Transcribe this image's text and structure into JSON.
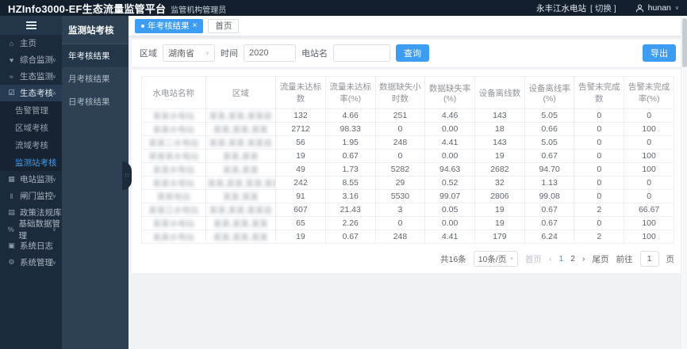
{
  "colors": {
    "accent": "#3d9df2",
    "header_bg": "#141f2e",
    "sidebar_bg": "#1c2b3b",
    "subpanel_bg": "#2e4154",
    "content_bg": "#f0f2f5",
    "table_border": "#ebeef5"
  },
  "header": {
    "title": "HZInfo3000-EF生态流量监管平台",
    "subtitle": "监管机构管理员",
    "station": "永丰江水电站",
    "switch_label": "[ 切换 ]",
    "user": "hunan",
    "user_icon": "person-icon",
    "caret": "∨"
  },
  "sidebar": {
    "menu_icon": "hamburger-menu-icon",
    "items": [
      {
        "type": "item",
        "icon": "home-icon",
        "glyph": "⌂",
        "label": "主页"
      },
      {
        "type": "item",
        "icon": "comprehensive-monitor-icon",
        "glyph": "♥",
        "label": "综合监测",
        "chev": "down"
      },
      {
        "type": "item",
        "icon": "eco-monitor-icon",
        "glyph": "≈",
        "label": "生态监测",
        "chev": "down"
      },
      {
        "type": "item",
        "icon": "eco-assess-icon",
        "glyph": "☑",
        "label": "生态考核",
        "chev": "up",
        "open": true
      },
      {
        "type": "sub",
        "label": "告警管理"
      },
      {
        "type": "sub",
        "label": "区域考核"
      },
      {
        "type": "sub",
        "label": "流域考核"
      },
      {
        "type": "sub",
        "label": "监测站考核",
        "active": true
      },
      {
        "type": "item",
        "icon": "station-monitor-icon",
        "glyph": "▦",
        "label": "电站监测",
        "chev": "down"
      },
      {
        "type": "item",
        "icon": "gate-control-icon",
        "glyph": "‖",
        "label": "闸门监控",
        "chev": "down"
      },
      {
        "type": "item",
        "icon": "policy-library-icon",
        "glyph": "▤",
        "label": "政策法规库"
      },
      {
        "type": "item",
        "icon": "base-data-icon",
        "glyph": "%",
        "label": "基础数据管理",
        "chev": "down"
      },
      {
        "type": "item",
        "icon": "system-log-icon",
        "glyph": "▣",
        "label": "系统日志"
      },
      {
        "type": "item",
        "icon": "system-manage-icon",
        "glyph": "⚙",
        "label": "系统管理",
        "chev": "down"
      }
    ]
  },
  "subpanel": {
    "title": "监测站考核",
    "items": [
      {
        "label": "年考核结果",
        "active": true
      },
      {
        "label": "月考核结果"
      },
      {
        "label": "日考核结果"
      }
    ]
  },
  "tabs": [
    {
      "label": "年考核结果",
      "active": true,
      "closable": true
    },
    {
      "label": "首页"
    }
  ],
  "filters": {
    "region_label": "区域",
    "region_value": "湖南省",
    "time_label": "时间",
    "time_value": "2020",
    "station_label": "电站名",
    "station_value": "",
    "search_label": "查询",
    "export_label": "导出"
  },
  "table": {
    "columns": [
      "水电站名称",
      "区域",
      "流量未达标数",
      "流量未达标率(%)",
      "数据缺失小时数",
      "数据缺失率(%)",
      "设备离线数",
      "设备离线率(%)",
      "告警未完成数",
      "告警未完成率(%)"
    ],
    "rows": [
      {
        "name": "某某水电站",
        "region": "某某,某某,某某县",
        "values": [
          "132",
          "4.66",
          "251",
          "4.46",
          "143",
          "5.05",
          "0",
          "0"
        ]
      },
      {
        "name": "某某水电站",
        "region": "某某,某某,某某",
        "values": [
          "2712",
          "98.33",
          "0",
          "0.00",
          "18",
          "0.66",
          "0",
          "100"
        ]
      },
      {
        "name": "某某二水电站",
        "region": "某某,某某,某某县",
        "values": [
          "56",
          "1.95",
          "248",
          "4.41",
          "143",
          "5.05",
          "0",
          "0"
        ]
      },
      {
        "name": "某某某水电站",
        "region": "某某,某某",
        "values": [
          "19",
          "0.67",
          "0",
          "0.00",
          "19",
          "0.67",
          "0",
          "100"
        ]
      },
      {
        "name": "某某水电站",
        "region": "某某,某某",
        "values": [
          "49",
          "1.73",
          "5282",
          "94.63",
          "2682",
          "94.70",
          "0",
          "100"
        ]
      },
      {
        "name": "某某水电站",
        "region": "某某,某某,某某,某某",
        "values": [
          "242",
          "8.55",
          "29",
          "0.52",
          "32",
          "1.13",
          "0",
          "0"
        ]
      },
      {
        "name": "某某电站",
        "region": "某某,某某",
        "values": [
          "91",
          "3.16",
          "5530",
          "99.07",
          "2806",
          "99.08",
          "0",
          "0"
        ]
      },
      {
        "name": "某某江水电站",
        "region": "某某,某某,某某县",
        "values": [
          "607",
          "21.43",
          "3",
          "0.05",
          "19",
          "0.67",
          "2",
          "66.67"
        ]
      },
      {
        "name": "某某水电站",
        "region": "某某,某某,某某",
        "values": [
          "65",
          "2.26",
          "0",
          "0.00",
          "19",
          "0.67",
          "0",
          "100"
        ]
      },
      {
        "name": "某某水电站",
        "region": "某某,某某,某某",
        "values": [
          "19",
          "0.67",
          "248",
          "4.41",
          "179",
          "6.24",
          "2",
          "100"
        ]
      }
    ]
  },
  "pagination": {
    "total": "共16条",
    "page_size": "10条/页",
    "first": "首页",
    "prev": "‹",
    "pages": [
      "1",
      "2"
    ],
    "current": "1",
    "next": "›",
    "last": "尾页",
    "goto_label": "前往",
    "goto_value": "1",
    "goto_unit": "页"
  }
}
